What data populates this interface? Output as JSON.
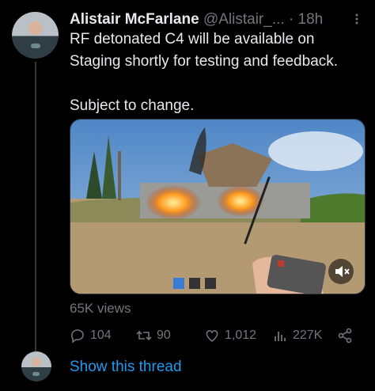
{
  "tweet": {
    "author": {
      "name": "Alistair McFarlane",
      "handle": "@Alistair_...",
      "dot": "·",
      "time": "18h"
    },
    "text": [
      "RF detonated C4 will be available on Staging shortly for testing and feedback.",
      "Subject to change."
    ],
    "media": {
      "type": "video",
      "mute_icon": "mute-icon",
      "description_icon": "video-thumbnail"
    },
    "views": "65K views",
    "actions": {
      "reply": {
        "count": "104",
        "icon": "reply-icon"
      },
      "retweet": {
        "count": "90",
        "icon": "retweet-icon"
      },
      "like": {
        "count": "1,012",
        "icon": "heart-icon"
      },
      "analytics": {
        "count": "227K",
        "icon": "analytics-icon"
      },
      "share": {
        "icon": "share-icon"
      }
    },
    "show_thread": "Show this thread"
  },
  "colors": {
    "background": "#000000",
    "text": "#e7e9ea",
    "muted": "#71767b",
    "link": "#1d9bf0"
  }
}
